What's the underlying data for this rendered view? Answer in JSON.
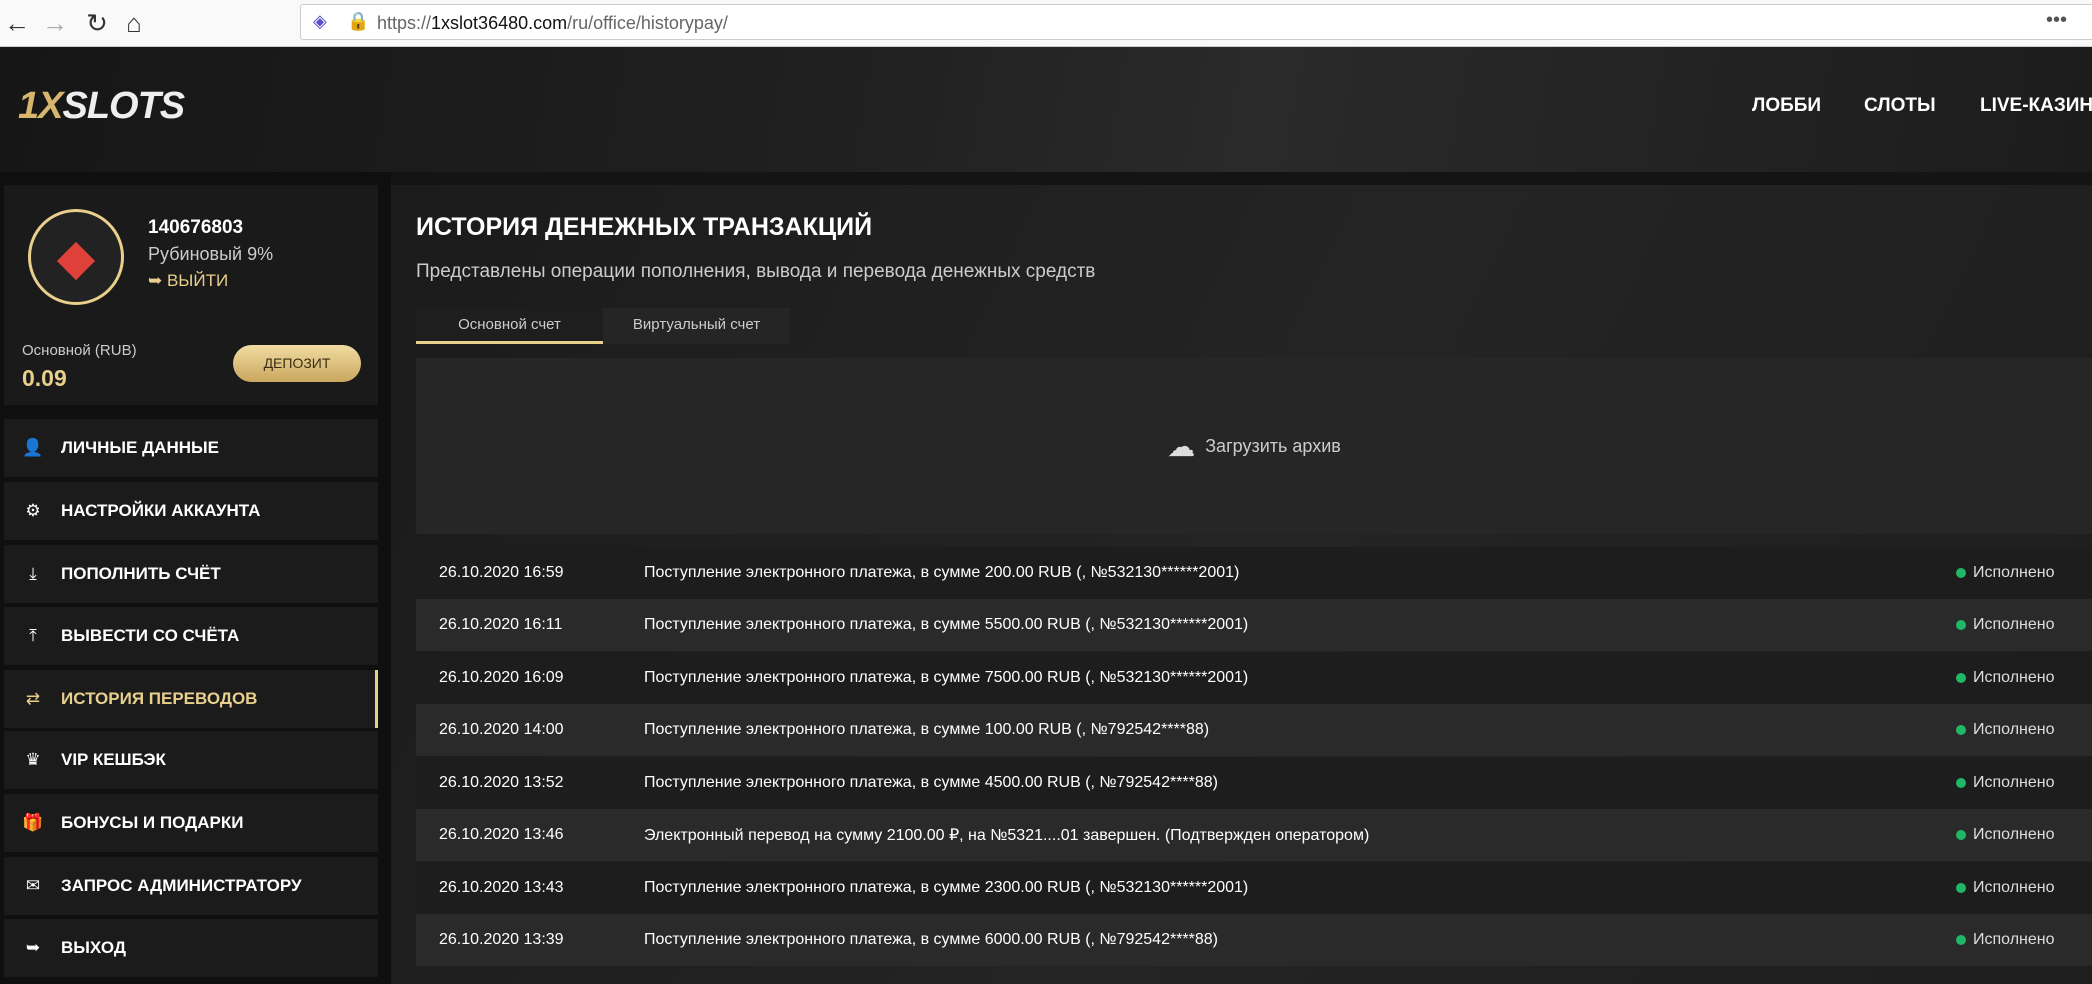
{
  "browser": {
    "url_prefix": "https://",
    "url_domain": "1xslot36480.com",
    "url_path": "/ru/office/historypay/"
  },
  "header": {
    "logo_a": "1X",
    "logo_b": "SLOTS",
    "nav": [
      "ЛОББИ",
      "СЛОТЫ",
      "LIVE-КАЗИНО"
    ]
  },
  "profile": {
    "user_id": "140676803",
    "rank": "Рубиновый 9%",
    "logout": "ВЫЙТИ",
    "balance_label": "Основной (RUB)",
    "balance": "0.09",
    "deposit": "ДЕПОЗИТ"
  },
  "sidebar": {
    "items": [
      {
        "label": "ЛИЧНЫЕ ДАННЫЕ",
        "icon": "user-plus-icon"
      },
      {
        "label": "НАСТРОЙКИ АККАУНТА",
        "icon": "gears-icon"
      },
      {
        "label": "ПОПОЛНИТЬ СЧЁТ",
        "icon": "download-icon"
      },
      {
        "label": "ВЫВЕСТИ СО СЧЁТА",
        "icon": "upload-icon"
      },
      {
        "label": "ИСТОРИЯ ПЕРЕВОДОВ",
        "icon": "exchange-icon"
      },
      {
        "label": "VIP КЕШБЭК",
        "icon": "crown-icon"
      },
      {
        "label": "БОНУСЫ И ПОДАРКИ",
        "icon": "gift-icon"
      },
      {
        "label": "ЗАПРОС АДМИНИСТРАТОРУ",
        "icon": "envelope-icon"
      },
      {
        "label": "ВЫХОД",
        "icon": "sign-out-icon"
      }
    ]
  },
  "main": {
    "title": "ИСТОРИЯ ДЕНЕЖНЫХ ТРАНЗАКЦИЙ",
    "subtitle": "Представлены операции пополнения, вывода и перевода денежных средств",
    "tabs": [
      "Основной счет",
      "Виртуальный счет"
    ],
    "archive": "Загрузить архив",
    "rows": [
      {
        "date": "26.10.2020 16:59",
        "desc": "Поступление электронного платежа, в сумме 200.00 RUB (, №532130******2001)",
        "status": "Исполнено"
      },
      {
        "date": "26.10.2020 16:11",
        "desc": "Поступление электронного платежа, в сумме 5500.00 RUB (, №532130******2001)",
        "status": "Исполнено"
      },
      {
        "date": "26.10.2020 16:09",
        "desc": "Поступление электронного платежа, в сумме 7500.00 RUB (, №532130******2001)",
        "status": "Исполнено"
      },
      {
        "date": "26.10.2020 14:00",
        "desc": "Поступление электронного платежа, в сумме 100.00 RUB (, №792542****88)",
        "status": "Исполнено"
      },
      {
        "date": "26.10.2020 13:52",
        "desc": "Поступление электронного платежа, в сумме 4500.00 RUB (, №792542****88)",
        "status": "Исполнено"
      },
      {
        "date": "26.10.2020 13:46",
        "desc": "Электронный перевод на сумму 2100.00 ₽, на №5321....01 завершен. (Подтвержден оператором)",
        "status": "Исполнено"
      },
      {
        "date": "26.10.2020 13:43",
        "desc": "Поступление электронного платежа, в сумме 2300.00 RUB (, №532130******2001)",
        "status": "Исполнено"
      },
      {
        "date": "26.10.2020 13:39",
        "desc": "Поступление электронного платежа, в сумме 6000.00 RUB (, №792542****88)",
        "status": "Исполнено"
      }
    ]
  },
  "colors": {
    "accent": "#e9cf8c",
    "success": "#1fb866"
  }
}
